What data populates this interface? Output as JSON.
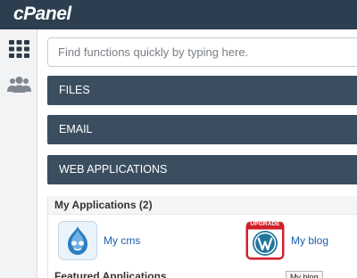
{
  "header": {
    "logo": "cPanel"
  },
  "sidebar": {
    "items": [
      {
        "icon": "grid-icon"
      },
      {
        "icon": "users-icon"
      }
    ]
  },
  "search": {
    "placeholder": "Find functions quickly by typing here."
  },
  "sections": {
    "files": "FILES",
    "email": "EMAIL",
    "web_applications": "WEB APPLICATIONS"
  },
  "my_applications": {
    "heading": "My Applications (2)",
    "apps": [
      {
        "label": "My cms",
        "icon": "drupal-icon"
      },
      {
        "label": "My blog",
        "icon": "wordpress-icon",
        "badge": "UPGRADE"
      }
    ]
  },
  "featured": {
    "heading": "Featured Applications"
  },
  "tooltip": {
    "text": "My blog"
  },
  "colors": {
    "topbar": "#2c3e50",
    "panel_header": "#3b4e60",
    "link": "#1b5fae",
    "upgrade_badge": "#d0202a"
  }
}
